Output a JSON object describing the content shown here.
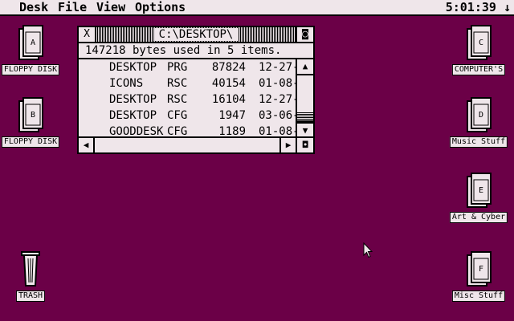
{
  "menubar": {
    "items": [
      "Desk",
      "File",
      "View",
      "Options"
    ],
    "clock": "5:01:39 ↓"
  },
  "desktop_icons": [
    {
      "label": "FLOPPY DISK",
      "letter": "A"
    },
    {
      "label": "FLOPPY DISK",
      "letter": "B"
    },
    {
      "label": "TRASH"
    },
    {
      "label": "COMPUTER'S",
      "letter": "C"
    },
    {
      "label": "Music Stuff",
      "letter": "D"
    },
    {
      "label": "Art & Cyber",
      "letter": "E"
    },
    {
      "label": "Misc Stuff",
      "letter": "F"
    }
  ],
  "window": {
    "title": "C:\\DESKTOP\\",
    "close_glyph": "X",
    "full_glyph": "◙",
    "info": "147218 bytes used in 5 items.",
    "files": [
      {
        "name": "DESKTOP",
        "ext": "PRG",
        "size": "87824",
        "date": "12-27-"
      },
      {
        "name": "ICONS",
        "ext": "RSC",
        "size": "40154",
        "date": "01-08-"
      },
      {
        "name": "DESKTOP",
        "ext": "RSC",
        "size": "16104",
        "date": "12-27-"
      },
      {
        "name": "DESKTOP",
        "ext": "CFG",
        "size": "1947",
        "date": "03-06-"
      },
      {
        "name": "GOODDESK",
        "ext": "CFG",
        "size": "1189",
        "date": "01-08-"
      }
    ],
    "scroll": {
      "up": "▲",
      "down": "▼",
      "left": "◀",
      "right": "▶",
      "size_glyph": "◘"
    }
  },
  "colors": {
    "desktop": "#6b0047",
    "window": "#efe6ea",
    "ink": "#000000"
  }
}
